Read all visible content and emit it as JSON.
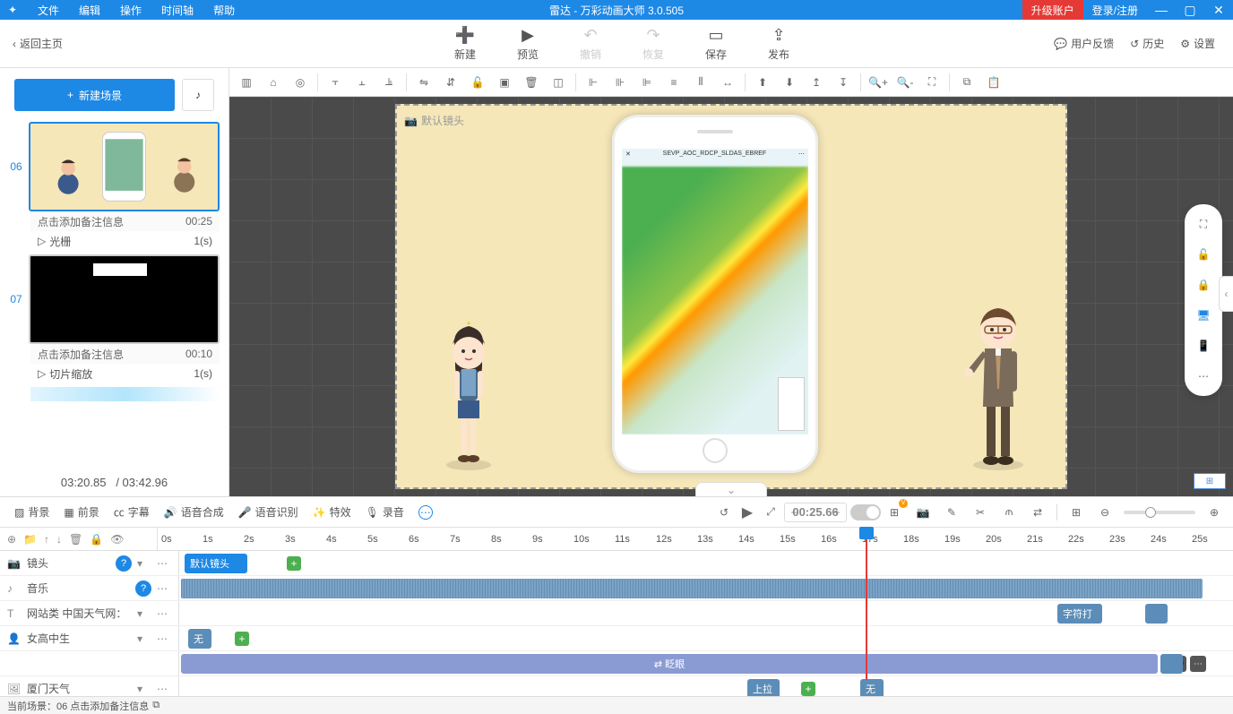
{
  "titlebar": {
    "menu": [
      "文件",
      "编辑",
      "操作",
      "时间轴",
      "帮助"
    ],
    "title": "雷达 - 万彩动画大师 3.0.505",
    "upgrade": "升级账户",
    "login": "登录/注册"
  },
  "back": "返回主页",
  "bigbuttons": {
    "new": "新建",
    "preview": "预览",
    "undo": "撤销",
    "redo": "恢复",
    "save": "保存",
    "publish": "发布"
  },
  "toolbar_right": {
    "feedback": "用户反馈",
    "history": "历史",
    "settings": "设置"
  },
  "scene": {
    "new": "新建场景",
    "items": [
      {
        "num": "06",
        "note": "点击添加备注信息",
        "time": "00:25",
        "action": "光栅",
        "actiontime": "1(s)"
      },
      {
        "num": "07",
        "note": "点击添加备注信息",
        "time": "00:10",
        "action": "切片缩放",
        "actiontime": "1(s)"
      }
    ],
    "time_current": "03:20.85",
    "time_total": "/ 03:42.96"
  },
  "canvas": {
    "stage_label": "默认镜头",
    "phone_title": "SEVP_AOC_RDCP_SLDAS_EBREF"
  },
  "tl_toolbar": {
    "bg": "背景",
    "fg": "前景",
    "subtitle": "字幕",
    "tts": "语音合成",
    "asr": "语音识别",
    "fx": "特效",
    "record": "录音",
    "time": "00:25.66"
  },
  "ruler": [
    "0s",
    "1s",
    "2s",
    "3s",
    "4s",
    "5s",
    "6s",
    "7s",
    "8s",
    "9s",
    "10s",
    "11s",
    "12s",
    "13s",
    "14s",
    "15s",
    "16s",
    "17s",
    "18s",
    "19s",
    "20s",
    "21s",
    "22s",
    "23s",
    "24s",
    "25s"
  ],
  "tracks": {
    "camera": {
      "name": "镜头",
      "clip": "默认镜头"
    },
    "music": {
      "name": "音乐"
    },
    "text": {
      "name": "网站类 中国天气网：",
      "tag": "字符打"
    },
    "girl": {
      "name": "女高中生",
      "wu": "无",
      "blink": "眨眼"
    },
    "weather": {
      "name": "厦门天气",
      "up": "上拉",
      "wu2": "无"
    }
  },
  "status": "当前场景：06   点击添加备注信息"
}
